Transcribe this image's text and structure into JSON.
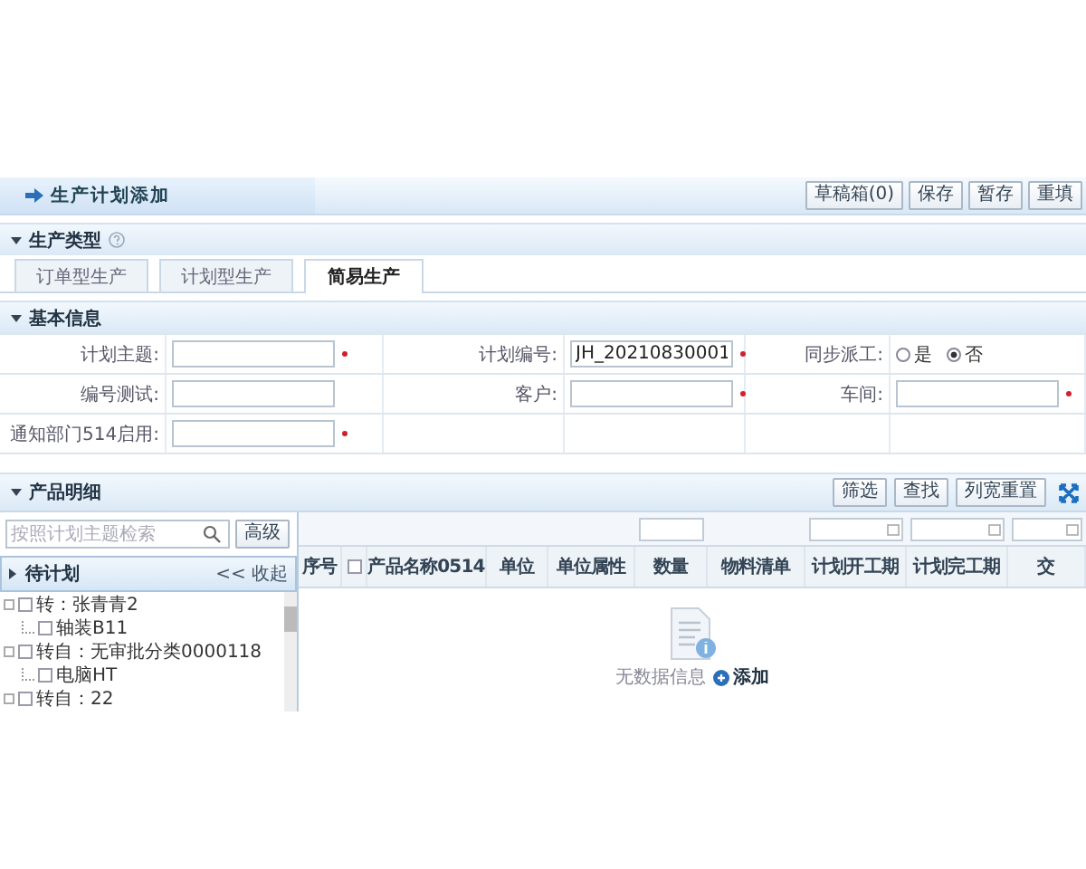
{
  "header": {
    "title": "生产计划添加",
    "buttons": [
      "草稿箱(0)",
      "保存",
      "暂存",
      "重填"
    ]
  },
  "type_section": {
    "title": "生产类型",
    "tabs": [
      {
        "label": "订单型生产",
        "selected": false
      },
      {
        "label": "计划型生产",
        "selected": false
      },
      {
        "label": "简易生产",
        "selected": true
      }
    ]
  },
  "basic_section": {
    "title": "基本信息",
    "rows": [
      [
        {
          "label": "计划主题:",
          "kind": "input",
          "required": true
        },
        {
          "label": "计划编号:",
          "kind": "input",
          "value": "JH_20210830001",
          "required": true
        },
        {
          "label": "同步派工:",
          "kind": "radio",
          "options": [
            {
              "label": "是",
              "selected": false
            },
            {
              "label": "否",
              "selected": true
            }
          ]
        }
      ],
      [
        {
          "label": "编号测试:",
          "kind": "input",
          "required": false
        },
        {
          "label": "客户:",
          "kind": "input",
          "required": true
        },
        {
          "label": "车间:",
          "kind": "input",
          "required": true
        }
      ],
      [
        {
          "label": "通知部门514启用:",
          "kind": "input",
          "required": true
        }
      ]
    ]
  },
  "detail_section": {
    "title": "产品明细",
    "buttons": [
      "筛选",
      "查找",
      "列宽重置"
    ]
  },
  "left_panel": {
    "search": {
      "placeholder": "按照计划主题检索"
    },
    "advanced_button": "高级",
    "title": "待计划",
    "collapse": "<< 收起",
    "tree": [
      {
        "label": "转：张青青2",
        "checked": false,
        "children": [
          {
            "label": "轴装B11",
            "checked": false
          }
        ]
      },
      {
        "label": "转自：无审批分类0000118",
        "checked": false,
        "children": [
          {
            "label": "电脑HT",
            "checked": false
          }
        ]
      },
      {
        "label": "转自：22",
        "checked": false
      }
    ]
  },
  "table": {
    "filters": [
      {
        "kind": "none"
      },
      {
        "kind": "none"
      },
      {
        "kind": "none"
      },
      {
        "kind": "none"
      },
      {
        "kind": "none"
      },
      {
        "kind": "text"
      },
      {
        "kind": "none"
      },
      {
        "kind": "date"
      },
      {
        "kind": "date"
      },
      {
        "kind": "date"
      }
    ],
    "columns": [
      {
        "kind": "text",
        "label": "序号"
      },
      {
        "kind": "checkbox",
        "checked": false
      },
      {
        "kind": "text",
        "label": "产品名称0514"
      },
      {
        "kind": "text",
        "label": "单位"
      },
      {
        "kind": "text",
        "label": "单位属性"
      },
      {
        "kind": "text",
        "label": "数量"
      },
      {
        "kind": "text",
        "label": "物料清单"
      },
      {
        "kind": "text",
        "label": "计划开工期"
      },
      {
        "kind": "text",
        "label": "计划完工期"
      },
      {
        "kind": "text",
        "label": "交"
      }
    ],
    "empty": {
      "message": "无数据信息",
      "action": "添加"
    }
  }
}
